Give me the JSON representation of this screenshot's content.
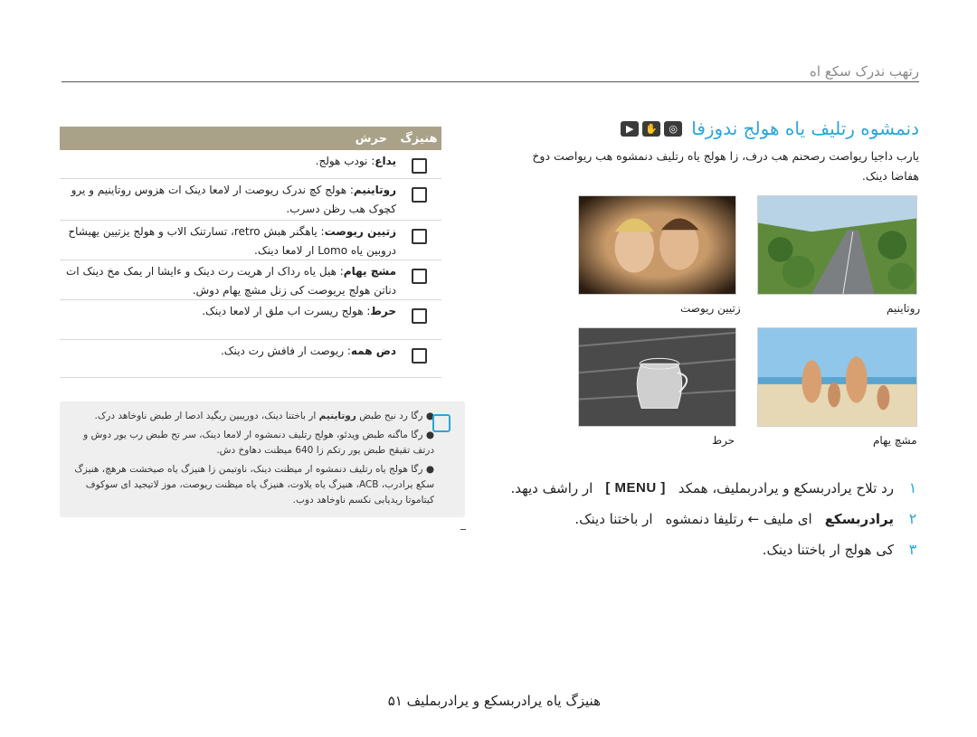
{
  "header": {
    "title": "رتهب ندرک سکع اه"
  },
  "section": {
    "title": "دنمشوه رتلیف یاه هولج ندوزفا",
    "mode_icons": [
      "camera-mode-icon",
      "dual-is-mode-icon",
      "movie-mode-icon"
    ]
  },
  "intro_text": "یارب داجیا ریواصت رصحنم هب درف، زا هولج یاه رتلیف دنمشوه هب ریواصت دوخ هفاضا دینک.",
  "photos": [
    {
      "caption": "روتاینیم",
      "scene": "highway"
    },
    {
      "caption": "زتیین ریوصت",
      "scene": "faces"
    },
    {
      "caption": "مشچ یهام",
      "scene": "beach"
    },
    {
      "caption": "حرط",
      "scene": "sketch"
    }
  ],
  "steps": [
    {
      "num": "۱",
      "text_before": "رد تلاح یرادربسکع و یرادربملیف، همکد",
      "key": "[ MENU ]",
      "text_after": "ار راشف دیهد."
    },
    {
      "num": "۲",
      "bold": "یرادربسکع",
      "text": "ای ملیف ← رتلیفا دنمشوه",
      "text_after": "ار باختنا دینک."
    },
    {
      "num": "۳",
      "text": "کی هولج ار باختنا دینک."
    }
  ],
  "table": {
    "col_icon": "هنیزگ",
    "col_desc": "حرش",
    "rows": [
      {
        "icon": "normal-icon",
        "label": "یداع",
        "desc": ": نودب هولج."
      },
      {
        "icon": "miniature-icon",
        "label": "روتاینیم",
        "desc": ": هولج کچ ندرک ریوصت ار لامعا دینک ات هزوس روتاینیم و یرو کچوک هب رظن دسرب."
      },
      {
        "icon": "vignetting-icon",
        "label": "زتیین ریوصت",
        "desc": ": یاهگنر هبش retro، تسارتنک الاب و هولج یزتیین یهیشاح دروبین یاه Lomo ار لامعا دینک."
      },
      {
        "icon": "fisheye-icon",
        "label": "مشچ یهام",
        "desc": ": هیل یاه رداک ار هریت رت دینک و ءایشا ار یمک مخ دینک ات دناتن هولج یریوصت کی زنل مشچ یهام دوش."
      },
      {
        "icon": "sketch-icon",
        "label": "حرط",
        "desc": ": هولج ریسرت اب ملق ار لامعا دینک."
      },
      {
        "icon": "defog-icon",
        "label": "دض همه",
        "desc": ": ریوصت ار فافش رت دینک."
      }
    ]
  },
  "notes": [
    {
      "prefix": "رگا رد نیح طبض",
      "bold": "روتاینیم",
      "text": "ار باختنا دینک، دوریبین ریگید ادصا ار طبض ناوخاهد درک."
    },
    {
      "text": "رگا ماگنه طبض ویدئو، هولج رتلیف دنمشوه ار لامعا دینک، سر تح طبض رب یور دوش و درتف تقیقح طبض یور رتکم زا 640 میظنت دهاوخ دش."
    },
    {
      "text": "رگا هولج یاه رتلیف دنمشوه ار میظنت دینک، ناوتیمن زا هنیزگ یاه صیخشت هرهچ، هنیزگ سکع یرادرب، ACB، هنیزگ یاه یلاوت، هنیزگ یاه میظنت ریوصت، موز لاتیجید ای سوکوف کیتاموتا ریدیابی نکسم ناوخاهد دوب."
    }
  ],
  "footer": {
    "text": "هنیزگ یاه یرادربسکع و یرادربملیف",
    "page": "۵۱"
  }
}
